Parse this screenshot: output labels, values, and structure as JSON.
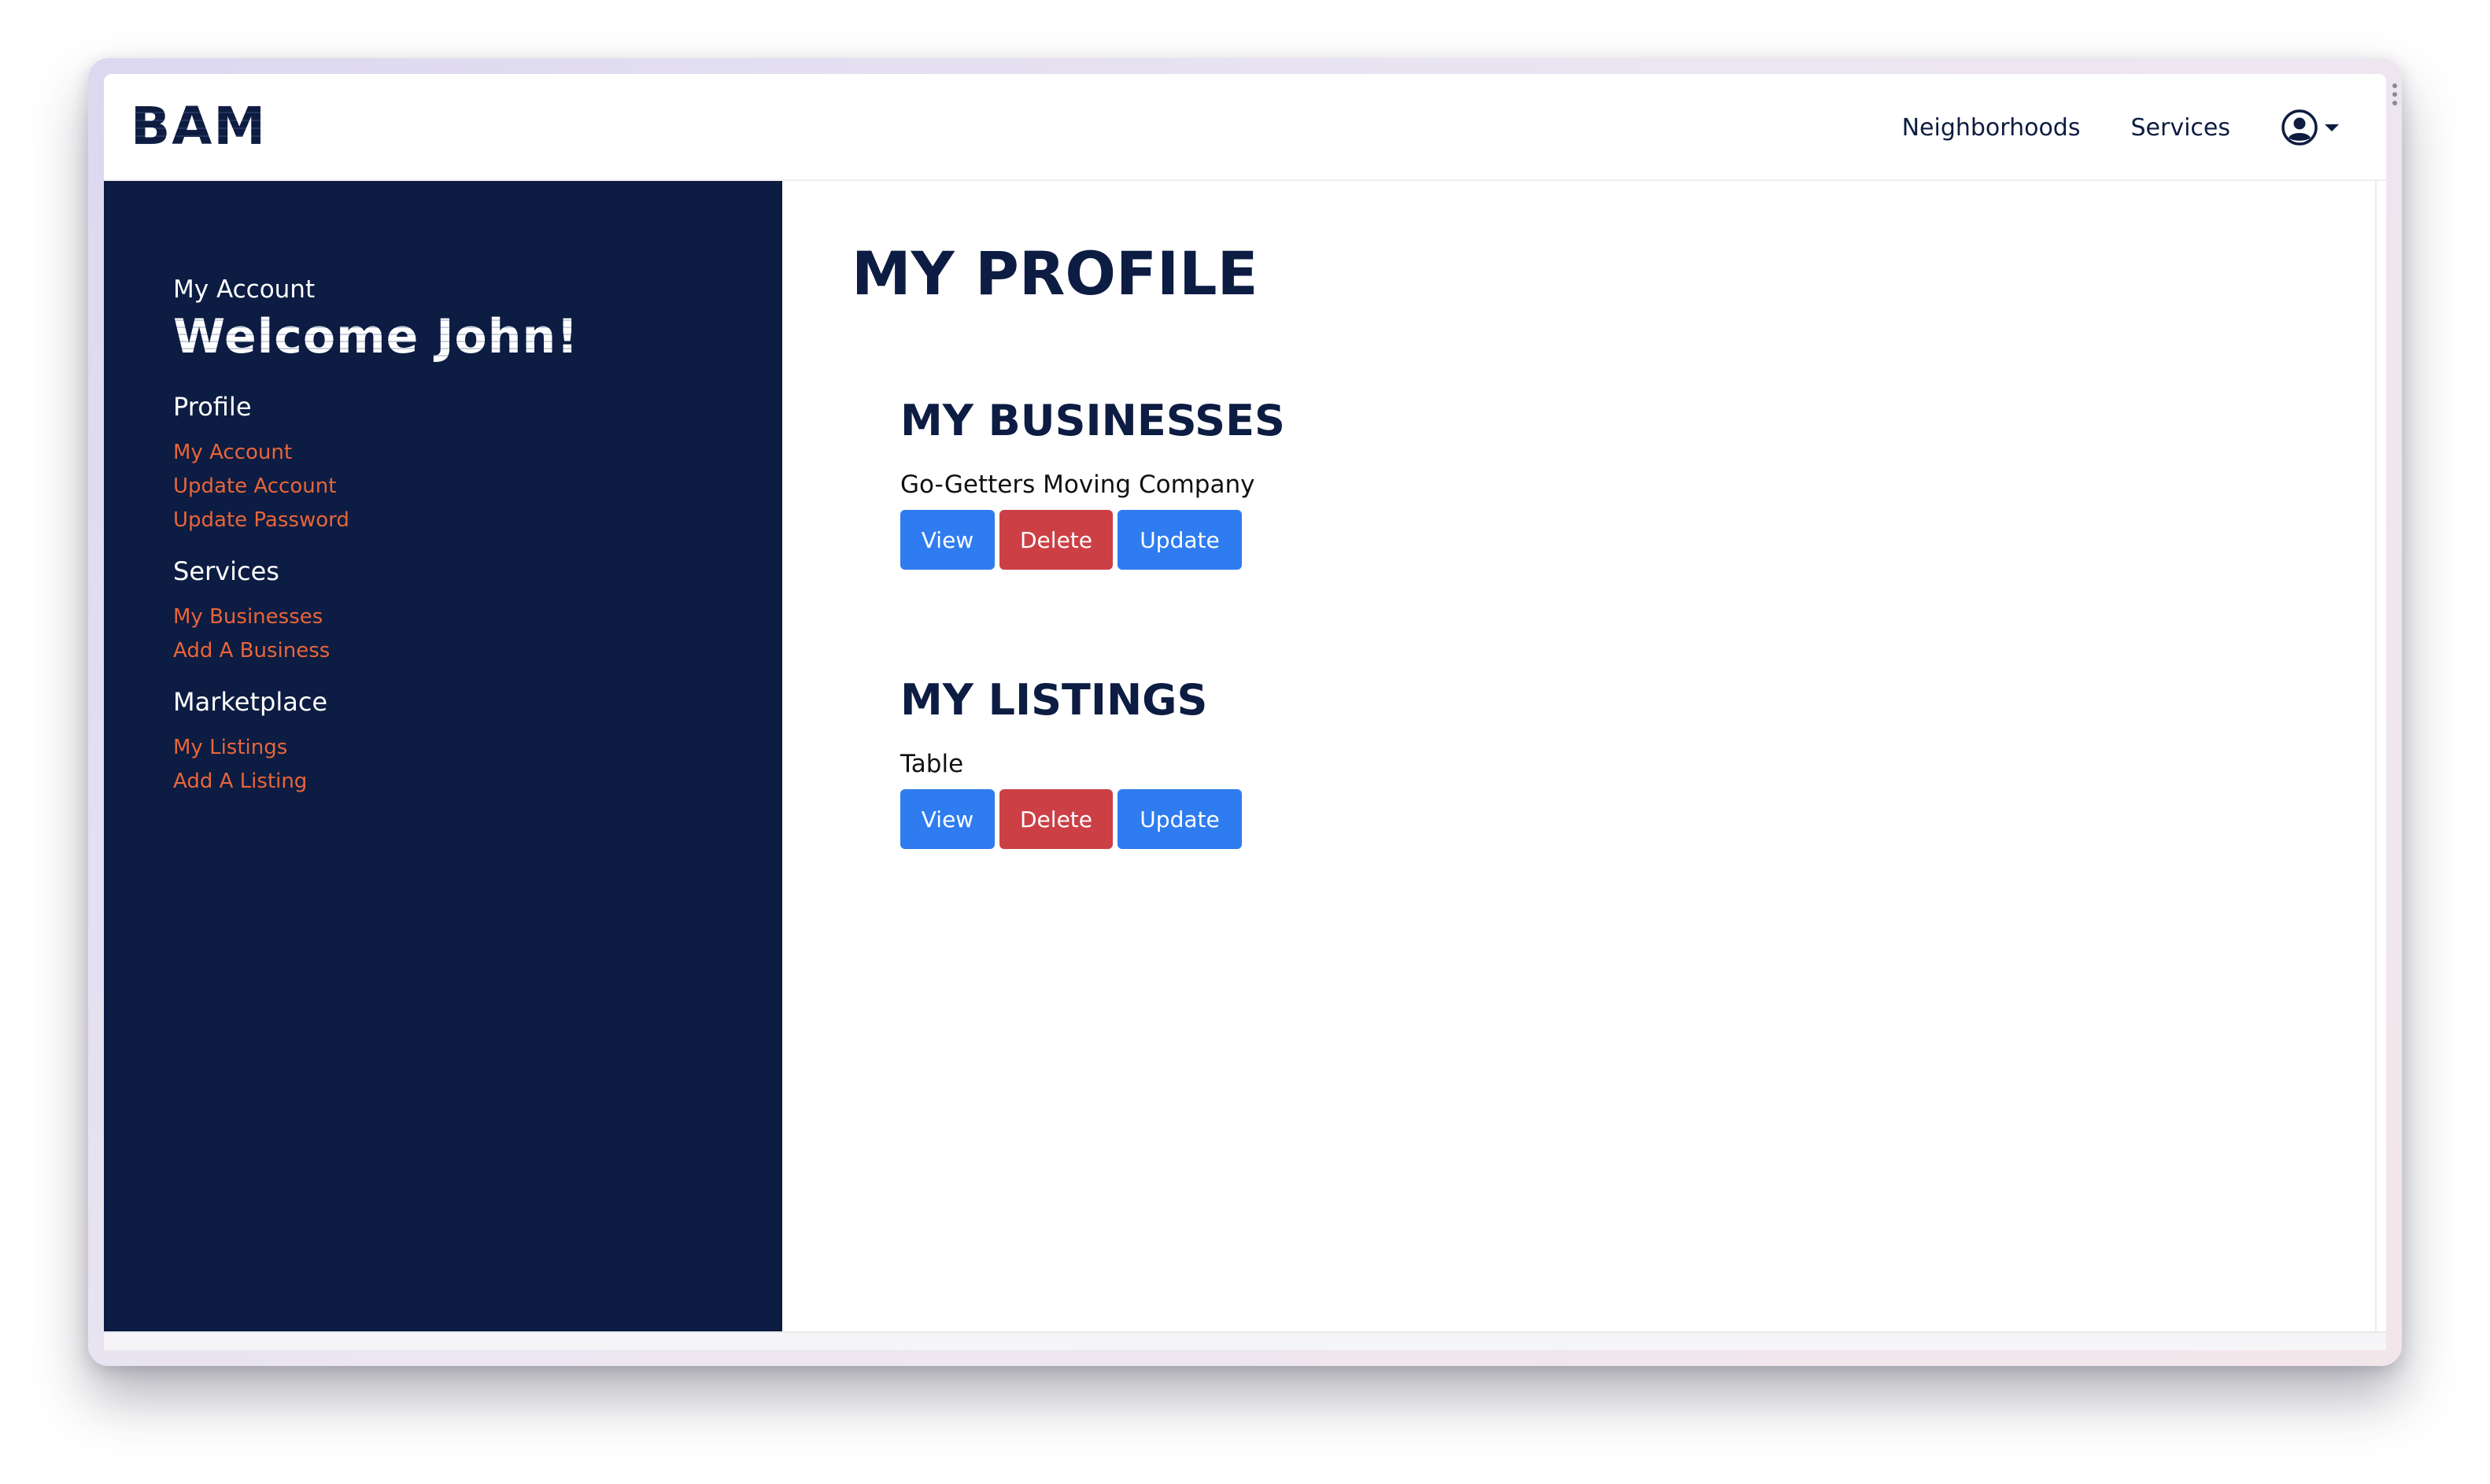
{
  "brand": {
    "logo_text": "BAM"
  },
  "nav": {
    "links": [
      "Neighborhoods",
      "Services"
    ],
    "user_icon": "user-circle-icon"
  },
  "sidebar": {
    "account_label": "My Account",
    "welcome": "Welcome John!",
    "sections": [
      {
        "heading": "Profile",
        "links": [
          "My Account",
          "Update Account",
          "Update Password"
        ]
      },
      {
        "heading": "Services",
        "links": [
          "My Businesses",
          "Add A Business"
        ]
      },
      {
        "heading": "Marketplace",
        "links": [
          "My Listings",
          "Add A Listing"
        ]
      }
    ]
  },
  "main": {
    "title": "MY PROFILE",
    "businesses": {
      "title": "MY BUSINESSES",
      "item": "Go-Getters Moving Company",
      "buttons": {
        "view": "View",
        "delete": "Delete",
        "update": "Update"
      }
    },
    "listings": {
      "title": "MY LISTINGS",
      "item": "Table",
      "buttons": {
        "view": "View",
        "delete": "Delete",
        "update": "Update"
      }
    }
  },
  "colors": {
    "navy": "#0c1c42",
    "link_orange": "#e8653a",
    "primary_blue": "#2f7cf0",
    "danger_red": "#cc4045"
  }
}
